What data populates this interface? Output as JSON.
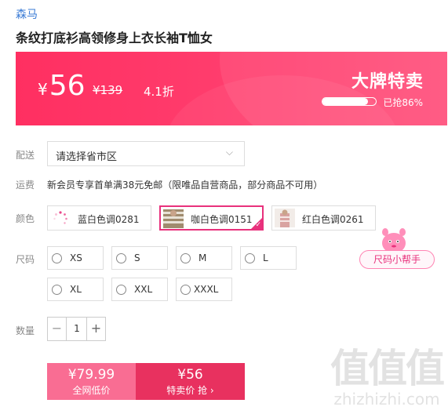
{
  "product": {
    "brand": "森马",
    "title": "条纹打底衫高领修身上衣长袖T恤女"
  },
  "banner": {
    "currency": "¥",
    "price": "56",
    "original_price": "¥139",
    "discount": "4.1折",
    "badge": "大牌特卖",
    "sold_text": "已抢86%",
    "sold_fraction": 0.86,
    "color": "#ff2f61"
  },
  "delivery": {
    "label": "配送",
    "placeholder": "请选择省市区"
  },
  "shipping": {
    "label": "运费",
    "text": "新会员专享首单满38元免邮（限唯品自营商品，部分商品不可用）"
  },
  "color": {
    "label": "颜色",
    "options": [
      {
        "name": "蓝白色调0281",
        "selected": false
      },
      {
        "name": "咖白色调0151",
        "selected": true
      },
      {
        "name": "红白色调0261",
        "selected": false
      }
    ],
    "accent": "#e8317c"
  },
  "size": {
    "label": "尺码",
    "options": [
      "XS",
      "S",
      "M",
      "L",
      "XL",
      "XXL",
      "XXXL"
    ],
    "helper": "尺码小帮手"
  },
  "quantity": {
    "label": "数量",
    "value": "1",
    "minus": "−",
    "plus": "+"
  },
  "purchase": {
    "web_price": "¥79.99",
    "web_label": "全网低价",
    "sale_price": "¥56",
    "sale_label": "特卖价 抢",
    "sale_arrow": "›"
  },
  "watermark": {
    "big": "值值值",
    "small": "zhizhizhi.com"
  }
}
